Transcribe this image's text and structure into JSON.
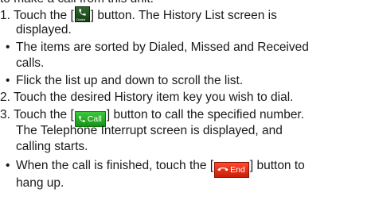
{
  "intro": "to make a call from this unit.",
  "steps": {
    "step1_before": "1. Touch the ",
    "step1_after": " button. The History List screen is",
    "step1_cont": "displayed.",
    "bullet1_a": "The items are sorted by Dialed, Missed and Received",
    "bullet1_b": "calls.",
    "bullet2": "Flick the list up and down to scroll the list.",
    "step2": "2. Touch the desired History item key you wish to dial.",
    "step3_before": "3. Touch the ",
    "step3_after": " button to call the specified number.",
    "step3_cont1": "The Telephone Interrupt screen is displayed, and",
    "step3_cont2": "calling starts.",
    "bullet3_before": "When the call is finished, touch the ",
    "bullet3_after": " button to",
    "bullet3_cont": "hang up.",
    "bullet_char": "•",
    "bracket_open": "[",
    "bracket_close": "]"
  },
  "icons": {
    "dialed_icon": "dialed-history-icon",
    "dialed_tiny_label": "Dialed",
    "call_label": "Call",
    "end_label": "End",
    "call_color": "#2bb12b",
    "end_color": "#e23314",
    "dialed_color": "#245a22"
  }
}
